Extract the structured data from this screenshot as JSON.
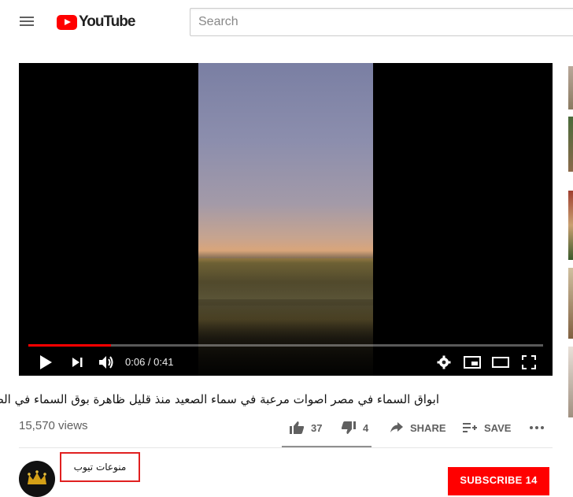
{
  "header": {
    "logo_text": "YouTube",
    "search_placeholder": "Search"
  },
  "player": {
    "current_time": "0:06",
    "duration": "0:41",
    "time_display": "0:06 / 0:41",
    "progress_fraction": 0.16,
    "accent_color": "#ff0000"
  },
  "video": {
    "title": "ابواق السماء في مصر اصوات مرعبة في سماء الصعيد منذ قليل ظاهرة بوق السماء في الصعيد",
    "views": "15,570 views"
  },
  "actions": {
    "likes": "37",
    "dislikes": "4",
    "share_label": "SHARE",
    "save_label": "SAVE"
  },
  "channel": {
    "name": "منوعات تيوب",
    "subscribe_label": "SUBSCRIBE",
    "subscriber_count": "14"
  },
  "icons": [
    "menu-icon",
    "youtube-logo-icon",
    "play-icon",
    "next-icon",
    "volume-icon",
    "settings-icon",
    "miniplayer-icon",
    "theater-icon",
    "fullscreen-icon",
    "thumbs-up-icon",
    "thumbs-down-icon",
    "share-icon",
    "playlist-add-icon",
    "more-icon",
    "crown-icon"
  ]
}
